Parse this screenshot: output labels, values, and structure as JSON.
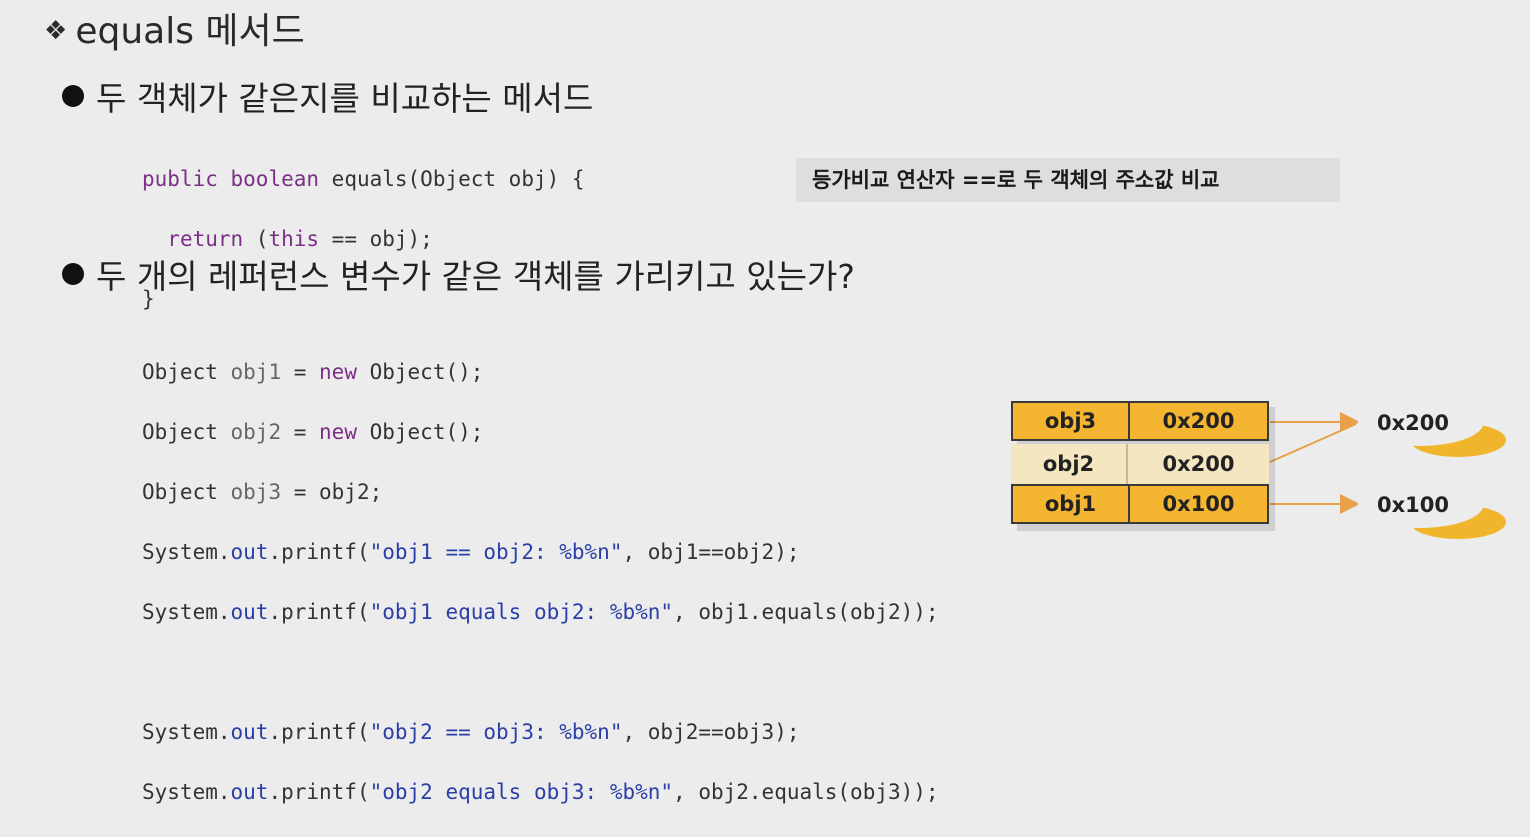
{
  "title": {
    "mark": "❖",
    "text": "equals 메서드"
  },
  "bullets": [
    {
      "text": "두 객체가 같은지를 비교하는 메서드"
    },
    {
      "text": "두 개의 레퍼런스 변수가 같은 객체를 가리키고 있는가?"
    }
  ],
  "code1": {
    "l1": {
      "kw1": "public",
      "kw2": "boolean",
      "rest": " equals(Object obj) {"
    },
    "l2": {
      "kw1": "return",
      "p1": " (",
      "kw2": "this",
      "p2": " == obj);"
    },
    "l3": {
      "text": "}"
    }
  },
  "note": "등가비교 연산자 ==로 두 객체의 주소값 비교",
  "code2": {
    "l1": {
      "a": "Object ",
      "v": "obj1",
      "b": " = ",
      "kw": "new",
      "c": " Object();"
    },
    "l2": {
      "a": "Object ",
      "v": "obj2",
      "b": " = ",
      "kw": "new",
      "c": " Object();"
    },
    "l3": {
      "a": "Object ",
      "v": "obj3",
      "b": " = obj2;"
    },
    "l4": {
      "a": "System.",
      "f": "out",
      "b": ".printf(",
      "s": "\"obj1 == obj2: %b%n\"",
      "c": ", obj1==obj2);"
    },
    "l5": {
      "a": "System.",
      "f": "out",
      "b": ".printf(",
      "s": "\"obj1 equals obj2: %b%n\"",
      "c": ", obj1.equals(obj2));"
    },
    "l6": {
      "a": "System.",
      "f": "out",
      "b": ".printf(",
      "s": "\"obj2 == obj3: %b%n\"",
      "c": ", obj2==obj3);"
    },
    "l7": {
      "a": "System.",
      "f": "out",
      "b": ".printf(",
      "s": "\"obj2 equals obj3: %b%n\"",
      "c": ", obj2.equals(obj3));"
    }
  },
  "diagram": {
    "rows": [
      {
        "name": "obj3",
        "addr": "0x200"
      },
      {
        "name": "obj2",
        "addr": "0x200"
      },
      {
        "name": "obj1",
        "addr": "0x100"
      }
    ],
    "objects": [
      "0x200",
      "0x100"
    ],
    "colors": {
      "gold": "#f4b531",
      "pale": "#f5e6c2",
      "arrow": "#e8a04a"
    }
  }
}
